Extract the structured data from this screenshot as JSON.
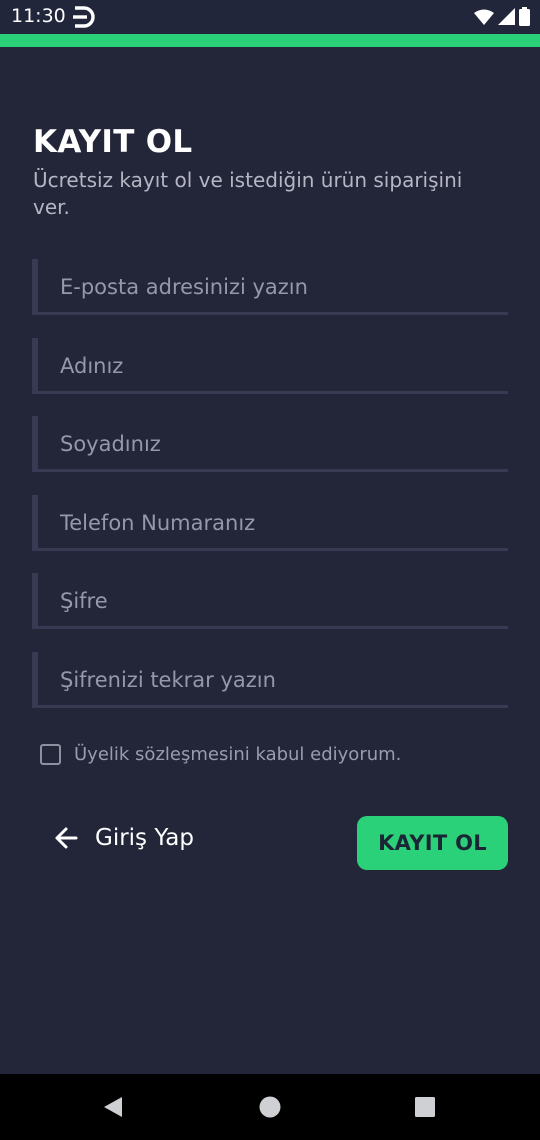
{
  "status_bar": {
    "time": "11:30"
  },
  "colors": {
    "background": "#232639",
    "accent": "#2bd178",
    "field_line": "#373a52",
    "placeholder": "#9598aa"
  },
  "page": {
    "title": "KAYIT OL",
    "subtitle": "Ücretsiz kayıt ol ve istediğin ürün siparişini ver."
  },
  "form": {
    "fields": [
      {
        "name": "email",
        "placeholder": "E-posta adresinizi yazın",
        "value": ""
      },
      {
        "name": "first-name",
        "placeholder": "Adınız",
        "value": ""
      },
      {
        "name": "last-name",
        "placeholder": "Soyadınız",
        "value": ""
      },
      {
        "name": "phone",
        "placeholder": "Telefon Numaranız",
        "value": ""
      },
      {
        "name": "password",
        "placeholder": "Şifre",
        "value": ""
      },
      {
        "name": "password-repeat",
        "placeholder": "Şifrenizi tekrar yazın",
        "value": ""
      }
    ],
    "agreement_label": "Üyelik sözleşmesini kabul ediyorum.",
    "agreement_checked": false
  },
  "actions": {
    "back_label": "Giriş Yap",
    "submit_label": "KAYIT OL"
  },
  "icons": {
    "status_app": "app-logo-icon",
    "wifi": "wifi-icon",
    "signal": "signal-icon",
    "battery": "battery-icon",
    "back_arrow": "arrow-left-icon",
    "nav_back": "nav-back-icon",
    "nav_home": "nav-home-icon",
    "nav_recents": "nav-recents-icon"
  }
}
